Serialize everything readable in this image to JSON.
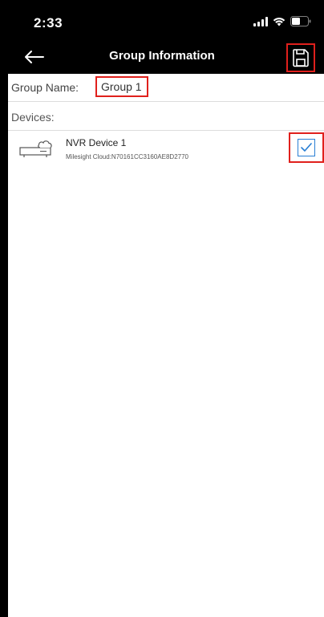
{
  "status_bar": {
    "time": "2:33",
    "signal_icon": "signal-bars-icon",
    "wifi_icon": "wifi-icon",
    "battery_icon": "battery-icon"
  },
  "nav": {
    "back_icon": "arrow-left-icon",
    "title": "Group Information",
    "save_icon": "floppy-disk-icon"
  },
  "form": {
    "group_name_label": "Group Name:",
    "group_name_value": "Group 1",
    "devices_label": "Devices:"
  },
  "devices": [
    {
      "name": "NVR Device 1",
      "subtitle": "Milesight Cloud:N70161CC3160AE8D2770",
      "icon": "nvr-device-icon",
      "checked": true
    }
  ],
  "colors": {
    "highlight_border": "#e0201c",
    "checkbox_accent": "#2a7fd4",
    "background_dark": "#000000",
    "content_background": "#ffffff"
  }
}
